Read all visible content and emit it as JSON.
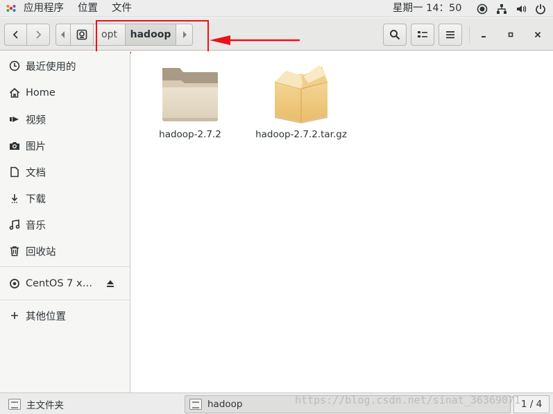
{
  "topbar": {
    "apps_label": "应用程序",
    "places_label": "位置",
    "file_label": "文件",
    "clock": "星期一 14：50",
    "tray_icons": [
      "accessibility-icon",
      "network-icon",
      "volume-icon",
      "power-icon"
    ]
  },
  "header": {
    "path": [
      "opt",
      "hadoop"
    ],
    "window_controls": [
      "minimize-icon",
      "maximize-icon",
      "close-icon"
    ]
  },
  "sidebar": {
    "items": [
      {
        "label": "最近使用的",
        "icon": "clock-icon"
      },
      {
        "label": "Home",
        "icon": "home-icon"
      },
      {
        "label": "视频",
        "icon": "video-icon"
      },
      {
        "label": "图片",
        "icon": "camera-icon"
      },
      {
        "label": "文档",
        "icon": "document-icon"
      },
      {
        "label": "下载",
        "icon": "download-icon"
      },
      {
        "label": "音乐",
        "icon": "music-icon"
      },
      {
        "label": "回收站",
        "icon": "trash-icon"
      }
    ],
    "device": {
      "label": "CentOS 7 x…",
      "icon": "disc-icon",
      "action_icon": "eject-icon"
    },
    "other": {
      "label": "其他位置",
      "icon": "plus-icon"
    }
  },
  "files": [
    {
      "name": "hadoop-2.7.2",
      "icon": "folder-icon"
    },
    {
      "name": "hadoop-2.7.2.tar.gz",
      "icon": "package-icon"
    }
  ],
  "taskbar": {
    "tasks": [
      "主文件夹",
      "hadoop"
    ],
    "pager": "1 / 4"
  },
  "watermark": "https://blog.csdn.net/sinat_36369071",
  "colors": {
    "highlight": "#e8121a",
    "folder": "#e4d9c5",
    "package": "#f1c97e"
  }
}
